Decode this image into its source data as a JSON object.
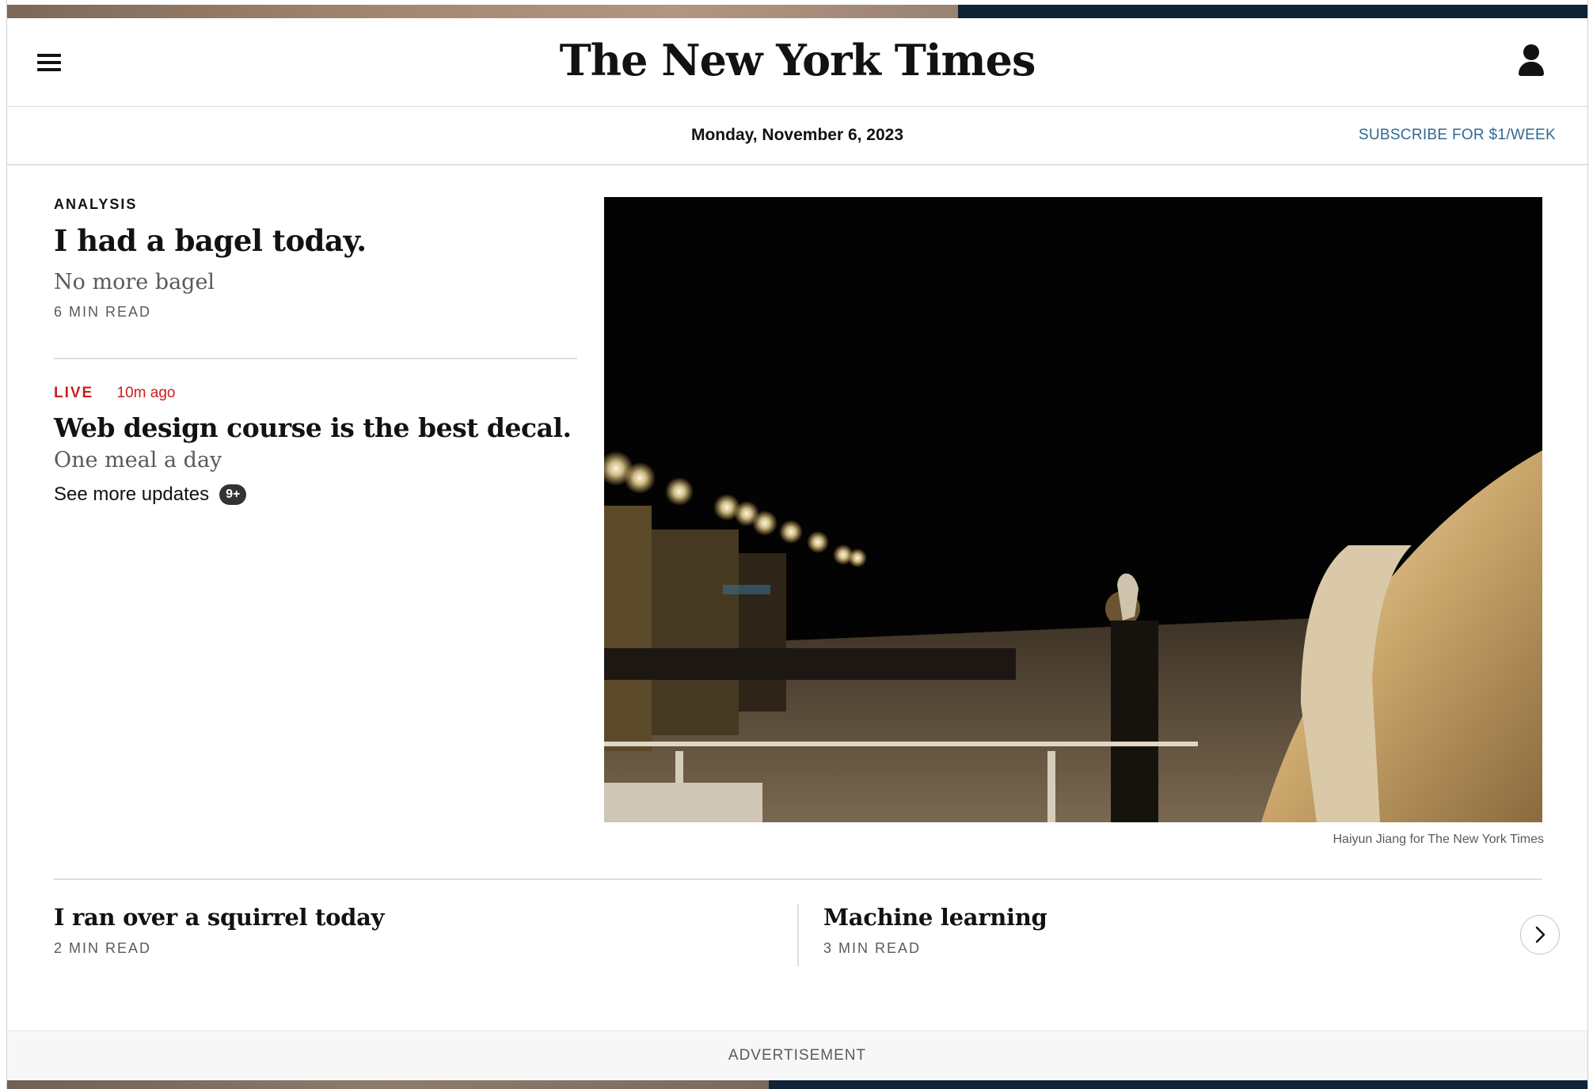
{
  "header": {
    "logo_text": "The New York Times",
    "menu_icon": "hamburger-menu-icon",
    "account_icon": "account-icon"
  },
  "datebar": {
    "date": "Monday, November 6, 2023",
    "subscribe_label": "SUBSCRIBE FOR $1/WEEK"
  },
  "stories": [
    {
      "kicker": "ANALYSIS",
      "headline": "I had a bagel today.",
      "summary": "No more bagel",
      "read_time": "6 MIN READ"
    },
    {
      "live_label": "LIVE",
      "time_ago": "10m ago",
      "headline": "Web design course is the best decal.",
      "summary": "One meal a day",
      "updates_label": "See more updates",
      "updates_badge": "9+"
    }
  ],
  "photo": {
    "credit": "Haiyun Jiang for The New York Times"
  },
  "secondary": [
    {
      "headline": "I ran over a squirrel today",
      "read_time": "2 MIN READ"
    },
    {
      "headline": "Machine learning",
      "read_time": "3 MIN READ"
    }
  ],
  "carousel": {
    "next_icon": "chevron-right-icon"
  },
  "ad": {
    "label": "ADVERTISEMENT"
  },
  "colors": {
    "live_red": "#c81e1e",
    "subscribe_blue": "#326891",
    "text": "#121212",
    "muted": "#5a5a5a"
  }
}
